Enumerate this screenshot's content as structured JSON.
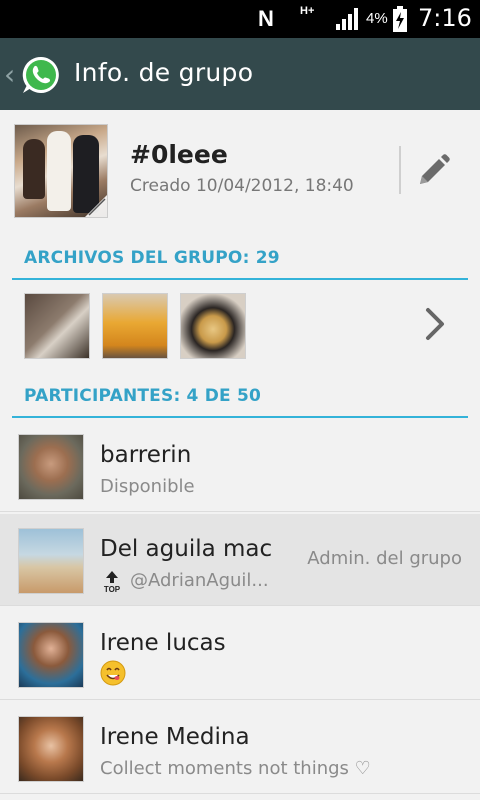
{
  "status_bar": {
    "notification": "N",
    "network": "H+",
    "battery_percent": "4%",
    "time": "7:16"
  },
  "action_bar": {
    "title": "Info. de grupo",
    "icon": "whatsapp-logo-icon"
  },
  "group": {
    "name": "#0leee",
    "created": "Creado 10/04/2012, 18:40",
    "edit_icon": "pencil-icon"
  },
  "media": {
    "header": "ARCHIVOS DEL GRUPO: 29",
    "thumbnails": [
      "photo-bed",
      "photo-beer",
      "photo-food"
    ]
  },
  "participants": {
    "header": "PARTICIPANTES: 4 DE 50",
    "items": [
      {
        "name": "barrerin",
        "status": "Disponible"
      },
      {
        "name": "Del aguila mac",
        "status": "@AdrianAguil...",
        "role": "Admin. del grupo",
        "status_icon": "top-arrow-icon"
      },
      {
        "name": "Irene lucas",
        "status": "",
        "status_icon": "smiley-face-icon"
      },
      {
        "name": "Irene Medina",
        "status": "Collect moments not things ♡"
      }
    ]
  },
  "colors": {
    "action_bar": "#33494c",
    "section_accent": "#34a2c7",
    "background": "#f2f2f2"
  }
}
